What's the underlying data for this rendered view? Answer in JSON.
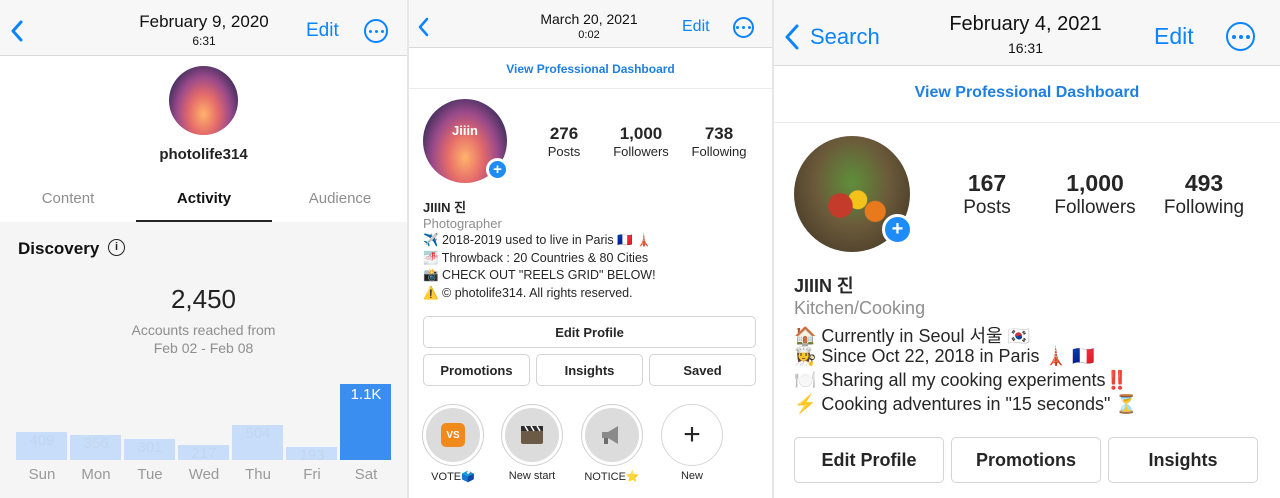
{
  "panel1": {
    "date": "February 9, 2020",
    "time": "6:31",
    "edit_label": "Edit",
    "username": "photolife314",
    "tabs": [
      "Content",
      "Activity",
      "Audience"
    ],
    "active_tab": "Activity",
    "section_title": "Discovery",
    "reach_value": "2,450",
    "reach_label": "Accounts reached from",
    "reach_range": "Feb 02 - Feb 08",
    "chart_data": {
      "type": "bar",
      "categories": [
        "Sun",
        "Mon",
        "Tue",
        "Wed",
        "Thu",
        "Fri",
        "Sat"
      ],
      "values": [
        409,
        356,
        301,
        217,
        504,
        193,
        1100
      ],
      "value_labels": [
        "409",
        "356",
        "301",
        "217",
        "504",
        "193",
        "1.1K"
      ],
      "highlighted": "Sat",
      "colors": {
        "bar": "#c7ddfa",
        "highlight": "#3a8ef0"
      }
    }
  },
  "panel2": {
    "date": "March 20, 2021",
    "time": "0:02",
    "edit_label": "Edit",
    "dashboard_link": "View Professional Dashboard",
    "avatar_text": "Jiiin",
    "stats": [
      {
        "value": "276",
        "label": "Posts"
      },
      {
        "value": "1,000",
        "label": "Followers"
      },
      {
        "value": "738",
        "label": "Following"
      }
    ],
    "name": "JIIIN 진",
    "category": "Photographer",
    "bio": [
      "✈️ 2018-2019 used to live in Paris 🇫🇷 🗼",
      "🌁 Throwback : 20 Countries & 80 Cities",
      "📸 CHECK OUT \"REELS GRID\" BELOW!",
      "⚠️ © photolife314. All rights reserved."
    ],
    "edit_profile": "Edit Profile",
    "buttons": [
      "Promotions",
      "Insights",
      "Saved"
    ],
    "highlights": [
      {
        "label": "VOTE🗳️",
        "icon": "VS"
      },
      {
        "label": "New start",
        "icon": "film-icon"
      },
      {
        "label": "NOTICE⭐",
        "icon": "megaphone-icon"
      },
      {
        "label": "New",
        "icon": "plus-icon"
      }
    ]
  },
  "panel3": {
    "back_label": "Search",
    "date": "February 4, 2021",
    "time": "16:31",
    "edit_label": "Edit",
    "dashboard_link": "View Professional Dashboard",
    "stats": [
      {
        "value": "167",
        "label": "Posts"
      },
      {
        "value": "1,000",
        "label": "Followers"
      },
      {
        "value": "493",
        "label": "Following"
      }
    ],
    "name": "JIIIN 진",
    "category": "Kitchen/Cooking",
    "bio": [
      "🏠 Currently in Seoul 서울 🇰🇷",
      "👩‍🍳 Since Oct 22, 2018 in Paris 🗼 🇫🇷",
      "🍽️ Sharing all my cooking experiments‼️",
      "⚡ Cooking adventures in \"15 seconds\" ⏳"
    ],
    "buttons": [
      "Edit Profile",
      "Promotions",
      "Insights"
    ]
  }
}
